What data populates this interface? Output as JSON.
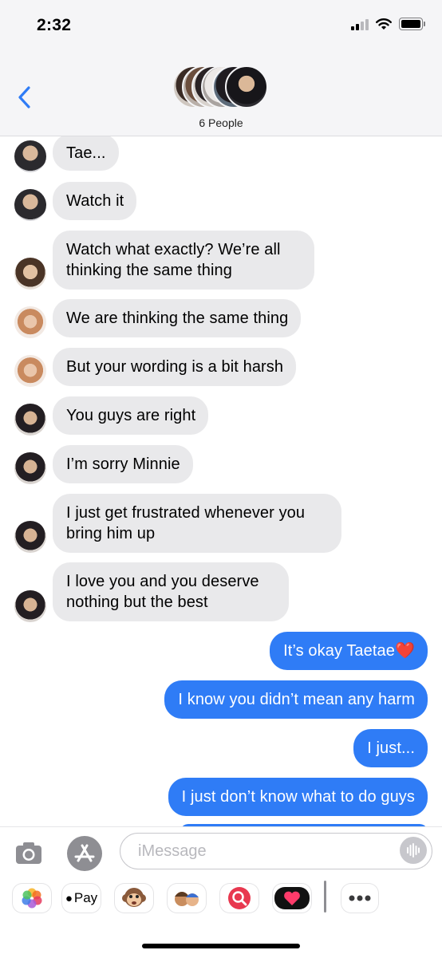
{
  "status_bar": {
    "time": "2:32",
    "signal_icon": "cellular-signal-icon",
    "wifi_icon": "wifi-icon",
    "battery_icon": "battery-icon"
  },
  "header": {
    "back_icon": "chevron-left-icon",
    "people_label": "6 People",
    "avatar_count": 6
  },
  "messages": [
    {
      "dir": "in",
      "text": "Tae...",
      "avatar": "a"
    },
    {
      "dir": "in",
      "text": "Watch it",
      "avatar": "a"
    },
    {
      "dir": "in",
      "text": "Watch what exactly? We’re all thinking the same thing",
      "avatar": "b"
    },
    {
      "dir": "in",
      "text": "We are thinking the same thing",
      "avatar": "c"
    },
    {
      "dir": "in",
      "text": "But your wording is a bit harsh",
      "avatar": "c"
    },
    {
      "dir": "in",
      "text": "You guys are right",
      "avatar": "d"
    },
    {
      "dir": "in",
      "text": "I’m sorry Minnie",
      "avatar": "d"
    },
    {
      "dir": "in",
      "text": "I just get frustrated whenever you bring him up",
      "avatar": "d"
    },
    {
      "dir": "in",
      "text": "I love you and you deserve nothing but the best",
      "avatar": "d"
    },
    {
      "dir": "out",
      "text": "It’s okay Taetae❤️"
    },
    {
      "dir": "out",
      "text": "I know you didn’t mean any harm"
    },
    {
      "dir": "out",
      "text": "I just..."
    },
    {
      "dir": "out",
      "text": "I just don’t know what to do guys"
    }
  ],
  "composer": {
    "placeholder": "iMessage",
    "camera_icon": "camera-icon",
    "app_store_icon": "app-store-icon",
    "audio_icon": "audio-waveform-icon"
  },
  "app_drawer": [
    {
      "name": "photos-app-icon",
      "label": ""
    },
    {
      "name": "apple-pay-icon",
      "label": "Pay"
    },
    {
      "name": "animoji-monkey-icon",
      "label": ""
    },
    {
      "name": "memoji-stickers-icon",
      "label": ""
    },
    {
      "name": "web-search-images-icon",
      "label": ""
    },
    {
      "name": "digital-touch-heart-icon",
      "label": ""
    },
    {
      "name": "more-apps-icon",
      "label": ""
    }
  ],
  "colors": {
    "outgoing_bubble": "#2f7cf6",
    "incoming_bubble": "#e9e9eb",
    "header_bg": "#f5f5f7"
  }
}
